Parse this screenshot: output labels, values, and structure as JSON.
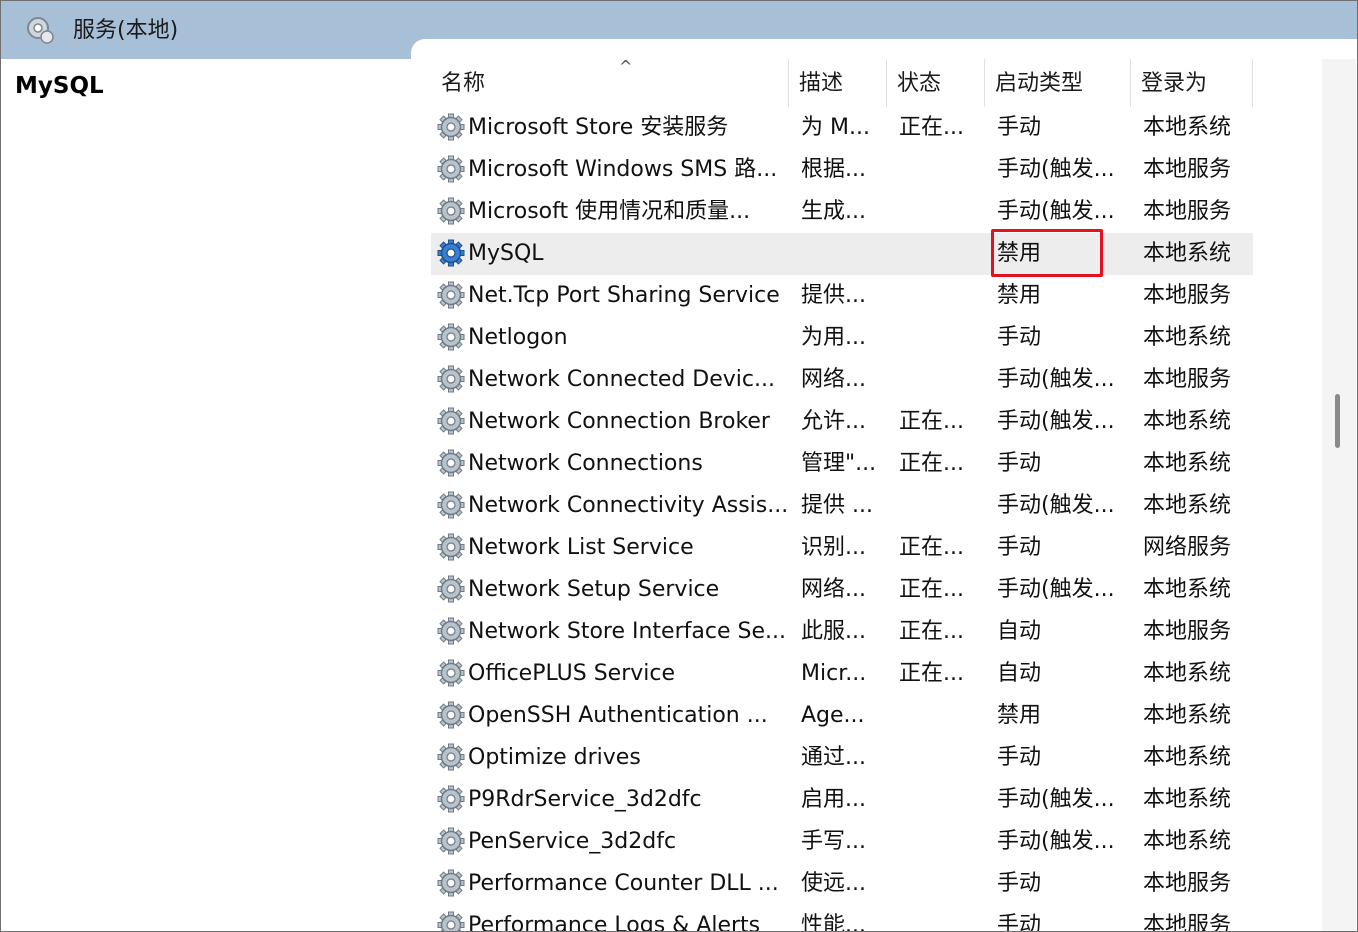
{
  "window": {
    "title": "服务(本地)"
  },
  "left_pane": {
    "selected_service": "MySQL"
  },
  "columns": [
    "名称",
    "描述",
    "状态",
    "启动类型",
    "登录为"
  ],
  "sort_indicator": "^",
  "services": [
    {
      "name": "Microsoft Store 安装服务",
      "desc": "为 M...",
      "status": "正在...",
      "startup": "手动",
      "logon": "本地系统",
      "icon": "gear-icon"
    },
    {
      "name": "Microsoft Windows SMS 路...",
      "desc": "根据...",
      "status": "",
      "startup": "手动(触发...",
      "logon": "本地服务",
      "icon": "gear-icon"
    },
    {
      "name": "Microsoft 使用情况和质量...",
      "desc": "生成...",
      "status": "",
      "startup": "手动(触发...",
      "logon": "本地服务",
      "icon": "gear-icon"
    },
    {
      "name": "MySQL",
      "desc": "",
      "status": "",
      "startup": "禁用",
      "logon": "本地系统",
      "icon": "gear-icon-blue",
      "selected": true,
      "highlighted": true
    },
    {
      "name": "Net.Tcp Port Sharing Service",
      "desc": "提供...",
      "status": "",
      "startup": "禁用",
      "logon": "本地服务",
      "icon": "gear-icon"
    },
    {
      "name": "Netlogon",
      "desc": "为用...",
      "status": "",
      "startup": "手动",
      "logon": "本地系统",
      "icon": "gear-icon"
    },
    {
      "name": "Network Connected Devic...",
      "desc": "网络...",
      "status": "",
      "startup": "手动(触发...",
      "logon": "本地服务",
      "icon": "gear-icon"
    },
    {
      "name": "Network Connection Broker",
      "desc": "允许...",
      "status": "正在...",
      "startup": "手动(触发...",
      "logon": "本地系统",
      "icon": "gear-icon"
    },
    {
      "name": "Network Connections",
      "desc": "管理\"...",
      "status": "正在...",
      "startup": "手动",
      "logon": "本地系统",
      "icon": "gear-icon"
    },
    {
      "name": "Network Connectivity Assis...",
      "desc": "提供 ...",
      "status": "",
      "startup": "手动(触发...",
      "logon": "本地系统",
      "icon": "gear-icon"
    },
    {
      "name": "Network List Service",
      "desc": "识别...",
      "status": "正在...",
      "startup": "手动",
      "logon": "网络服务",
      "icon": "gear-icon"
    },
    {
      "name": "Network Setup Service",
      "desc": "网络...",
      "status": "正在...",
      "startup": "手动(触发...",
      "logon": "本地系统",
      "icon": "gear-icon"
    },
    {
      "name": "Network Store Interface Se...",
      "desc": "此服...",
      "status": "正在...",
      "startup": "自动",
      "logon": "本地服务",
      "icon": "gear-icon"
    },
    {
      "name": "OfficePLUS Service",
      "desc": "Micr...",
      "status": "正在...",
      "startup": "自动",
      "logon": "本地系统",
      "icon": "gear-icon"
    },
    {
      "name": "OpenSSH Authentication ...",
      "desc": "Age...",
      "status": "",
      "startup": "禁用",
      "logon": "本地系统",
      "icon": "gear-icon"
    },
    {
      "name": "Optimize drives",
      "desc": "通过...",
      "status": "",
      "startup": "手动",
      "logon": "本地系统",
      "icon": "gear-icon"
    },
    {
      "name": "P9RdrService_3d2dfc",
      "desc": "启用...",
      "status": "",
      "startup": "手动(触发...",
      "logon": "本地系统",
      "icon": "gear-icon"
    },
    {
      "name": "PenService_3d2dfc",
      "desc": "手写...",
      "status": "",
      "startup": "手动(触发...",
      "logon": "本地系统",
      "icon": "gear-icon"
    },
    {
      "name": "Performance Counter DLL ...",
      "desc": "使远...",
      "status": "",
      "startup": "手动",
      "logon": "本地服务",
      "icon": "gear-icon"
    },
    {
      "name": "Performance Logs & Alerts",
      "desc": "性能...",
      "status": "",
      "startup": "手动",
      "logon": "本地服务",
      "icon": "gear-icon"
    }
  ],
  "colors": {
    "titlebar": "#a8bfd8",
    "selected_row": "#ededed",
    "highlight": "#e3101e"
  }
}
